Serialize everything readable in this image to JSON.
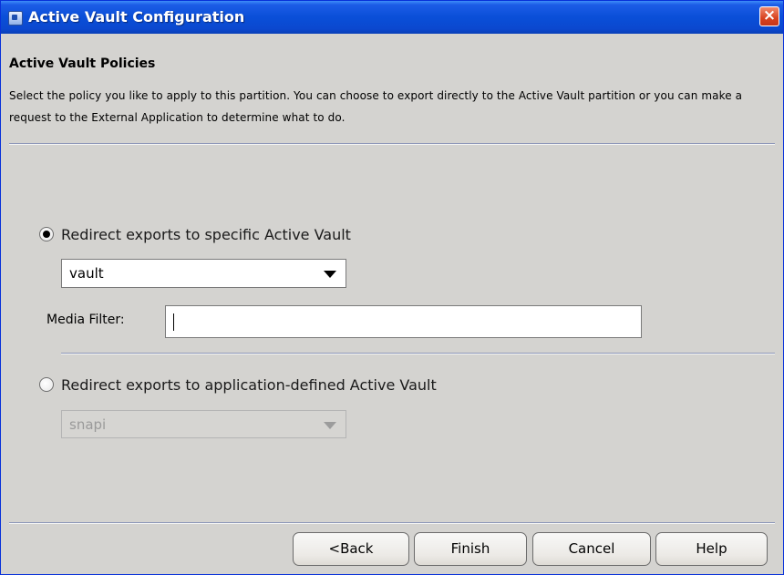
{
  "window": {
    "title": "Active Vault Configuration",
    "close_label": "×"
  },
  "header": {
    "title": "Active Vault Policies",
    "description": "Select the policy you like to apply to this partition. You can choose to export directly to the Active Vault partition or you can make a request to the External Application to determine what to do."
  },
  "options": {
    "specific": {
      "label": "Redirect exports to specific Active Vault",
      "selected": true,
      "vault_value": "vault"
    },
    "media_filter": {
      "label": "Media Filter:",
      "value": ""
    },
    "application": {
      "label": "Redirect exports to application-defined Active Vault",
      "selected": false,
      "vault_value": "snapi",
      "disabled": true
    }
  },
  "buttons": {
    "back": "<Back",
    "finish": "Finish",
    "cancel": "Cancel",
    "help": "Help"
  },
  "colors": {
    "titlebar": "#0a4fd8",
    "dialog_bg": "#d4d3d0",
    "close_button": "#d8421f"
  }
}
